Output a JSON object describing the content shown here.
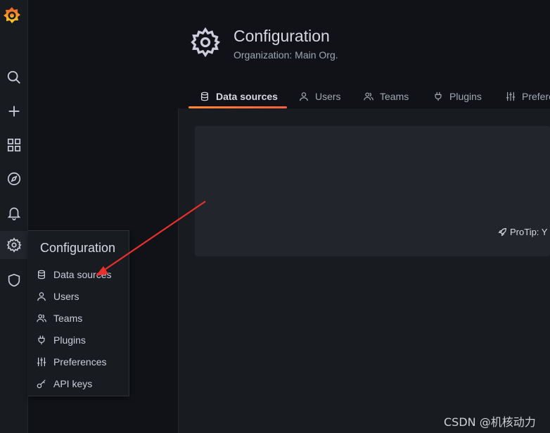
{
  "page": {
    "title": "Configuration",
    "subtitle": "Organization: Main Org."
  },
  "tabs": [
    {
      "label": "Data sources",
      "icon": "database-icon",
      "active": true
    },
    {
      "label": "Users",
      "icon": "user-icon"
    },
    {
      "label": "Teams",
      "icon": "users-icon"
    },
    {
      "label": "Plugins",
      "icon": "plug-icon"
    },
    {
      "label": "Preferences",
      "icon": "sliders-icon"
    }
  ],
  "sidebar": {
    "items": [
      {
        "icon": "grafana-logo"
      },
      {
        "icon": "search-icon"
      },
      {
        "icon": "plus-icon"
      },
      {
        "icon": "dashboards-icon"
      },
      {
        "icon": "compass-icon"
      },
      {
        "icon": "bell-icon"
      },
      {
        "icon": "gear-icon",
        "active": true
      },
      {
        "icon": "shield-icon"
      }
    ]
  },
  "flyout": {
    "title": "Configuration",
    "items": [
      {
        "label": "Data sources",
        "icon": "database-icon"
      },
      {
        "label": "Users",
        "icon": "user-icon"
      },
      {
        "label": "Teams",
        "icon": "users-icon"
      },
      {
        "label": "Plugins",
        "icon": "plug-icon"
      },
      {
        "label": "Preferences",
        "icon": "sliders-icon"
      },
      {
        "label": "API keys",
        "icon": "key-icon"
      }
    ]
  },
  "content": {
    "protip": "ProTip: Y"
  },
  "annotation": {
    "color": "#e8312c"
  },
  "watermark": "CSDN @机核动力",
  "colors": {
    "accent": "#ff8833",
    "background": "#111217",
    "panel": "#181b1f"
  }
}
